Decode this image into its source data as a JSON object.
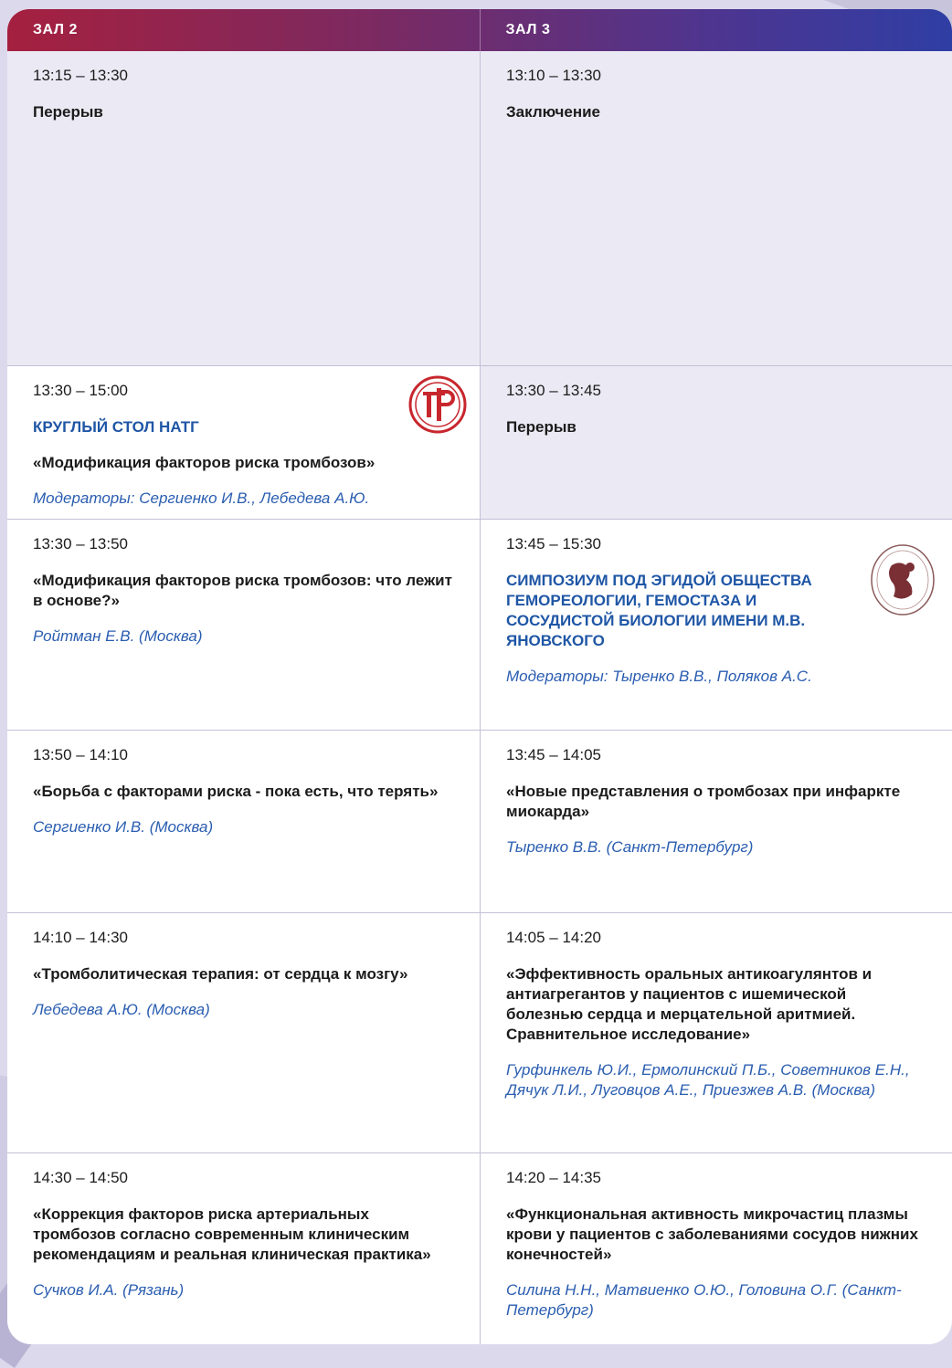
{
  "header": {
    "hall2": "ЗАЛ 2",
    "hall3": "ЗАЛ 3"
  },
  "rows": [
    {
      "left": {
        "time": "13:15 – 13:30",
        "title": "Перерыв"
      },
      "right": {
        "time": "13:10 – 13:30",
        "title": "Заключение"
      }
    },
    {
      "left": {
        "time": "13:30 – 15:00",
        "caps": "КРУГЛЫЙ СТОЛ НАТГ",
        "title": "«Модификация факторов риска тромбозов»",
        "author": "Модераторы: Сергиенко И.В., Лебедева А.Ю."
      },
      "right": {
        "time": "13:30 – 13:45",
        "title": "Перерыв"
      }
    },
    {
      "left": {
        "time": "13:30 – 13:50",
        "title": "«Модификация факторов риска тромбозов: что лежит в основе?»",
        "author": "Ройтман Е.В. (Москва)"
      },
      "right": {
        "time": "13:45 – 15:30",
        "caps": "СИМПОЗИУМ ПОД ЭГИДОЙ ОБЩЕСТВА ГЕМОРЕОЛОГИИ, ГЕМОСТАЗА И СОСУДИСТОЙ БИОЛОГИИ ИМЕНИ М.В. ЯНОВСКОГО",
        "author": "Модераторы: Тыренко В.В., Поляков А.С."
      }
    },
    {
      "left": {
        "time": "13:50 – 14:10",
        "title": "«Борьба с факторами риска - пока есть, что терять»",
        "author": "Сергиенко И.В. (Москва)"
      },
      "right": {
        "time": "13:45 – 14:05",
        "title": "«Новые представления о тромбозах при инфаркте миокарда»",
        "author": "Тыренко В.В. (Санкт-Петербург)"
      }
    },
    {
      "left": {
        "time": "14:10 – 14:30",
        "title": "«Тромболитическая терапия: от сердца к мозгу»",
        "author": "Лебедева А.Ю. (Москва)"
      },
      "right": {
        "time": "14:05 – 14:20",
        "title": "«Эффективность оральных антикоагулянтов и антиагрегантов у пациентов с ишемической болезнью сердца и мерцательной аритмией. Сравнительное исследование»",
        "author": "Гурфинкель Ю.И., Ермолинский П.Б., Советников Е.Н., Дячук Л.И., Луговцов А.Е., Приезжев А.В. (Москва)"
      }
    },
    {
      "left": {
        "time": "14:30 – 14:50",
        "title": "«Коррекция факторов риска артериальных тромбозов согласно современным клиническим рекомендациям и реальная клиническая практика»",
        "author": "Сучков И.А. (Рязань)"
      },
      "right": {
        "time": "14:20 – 14:35",
        "title": "«Функциональная активность микрочастиц плазмы крови у пациентов с заболеваниями сосудов нижних конечностей»",
        "author": "Силина Н.Н., Матвиенко О.Ю., Головина О.Г. (Санкт-Петербург)"
      }
    }
  ],
  "icons": {
    "natg_logo": "natg-logo-icon",
    "society_logo": "society-emblem-icon"
  },
  "colors": {
    "accent_blue": "#1f56a5",
    "header_start": "#a5203f",
    "header_end": "#2f3ea4"
  }
}
